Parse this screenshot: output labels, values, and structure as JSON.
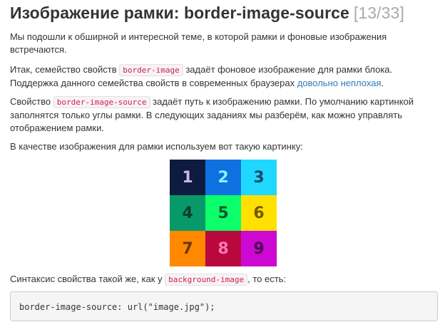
{
  "title": {
    "text": "Изображение рамки: border-image-source",
    "counter": "[13/33]"
  },
  "paragraphs": {
    "p1": "Мы подошли к обширной и интересной теме, в которой рамки и фоновые изображения встречаются.",
    "p2_before": "Итак, семейство свойств ",
    "p2_code": "border-image",
    "p2_mid": " задаёт фоновое изображение для рамки блока. Поддержка данного семейства свойств в современных браузерах ",
    "p2_link": "довольно неплохая",
    "p2_after": ".",
    "p3_before": "Свойство ",
    "p3_code": "border-image-source",
    "p3_after": " задаёт путь к изображению рамки. По умолчанию картинкой заполнятся только углы рамки. В следующих заданиях мы разберём, как можно управлять отображением рамки.",
    "p4": "В качестве изображения для рамки используем вот такую картинку:",
    "p5_before": "Синтаксис свойства такой же, как у ",
    "p5_code": "background-image",
    "p5_after": ", то есть:"
  },
  "image_grid": {
    "cells": [
      {
        "label": "1",
        "bg": "#0d1b3e",
        "fg": "#c8b8f0"
      },
      {
        "label": "2",
        "bg": "#0d72e0",
        "fg": "#8ef0ff"
      },
      {
        "label": "3",
        "bg": "#20d8ff",
        "fg": "#1a4a66"
      },
      {
        "label": "4",
        "bg": "#08996a",
        "fg": "#0c3d2a"
      },
      {
        "label": "5",
        "bg": "#0cff6a",
        "fg": "#0a5a2a"
      },
      {
        "label": "6",
        "bg": "#ffe000",
        "fg": "#705800"
      },
      {
        "label": "7",
        "bg": "#ff8800",
        "fg": "#6a3a00"
      },
      {
        "label": "8",
        "bg": "#b8083e",
        "fg": "#ff78b8"
      },
      {
        "label": "9",
        "bg": "#cc08d2",
        "fg": "#4a0a4e"
      }
    ]
  },
  "code_block": "border-image-source: url(\"image.jpg\");"
}
